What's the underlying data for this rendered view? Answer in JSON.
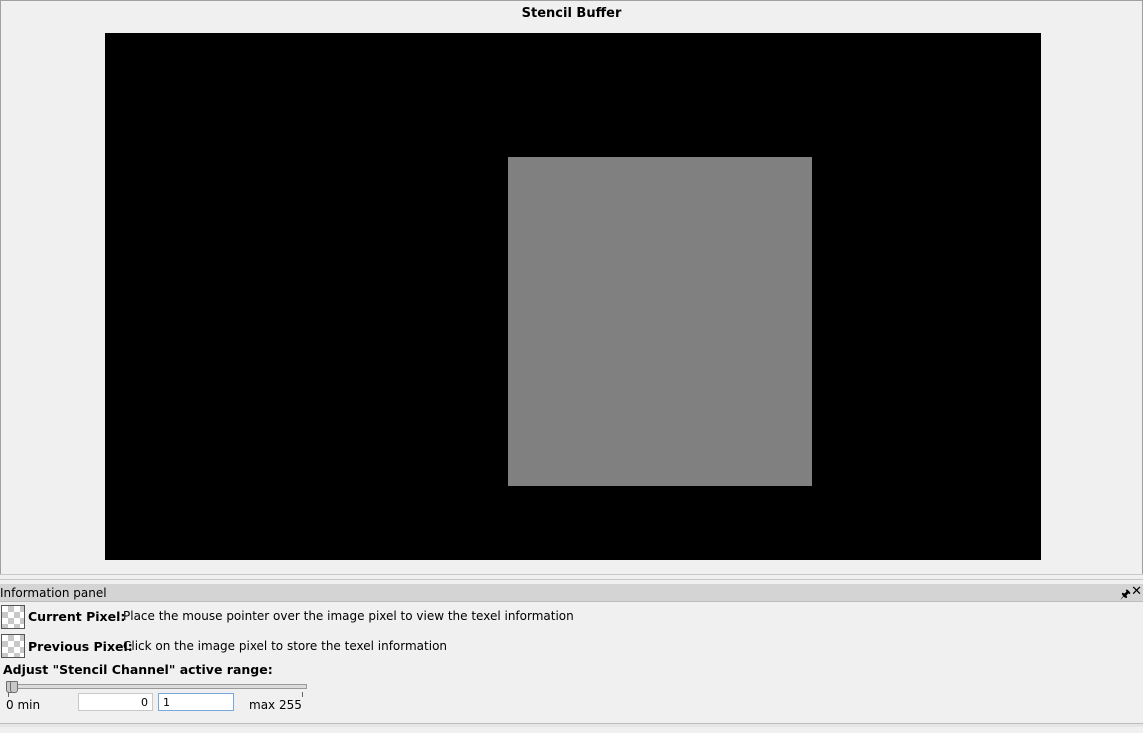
{
  "viewer": {
    "title": "Stencil Buffer"
  },
  "panel": {
    "title": "Information panel",
    "pin_icon": "pin-icon",
    "close_icon": "close-icon",
    "current_pixel": {
      "label": "Current Pixel:",
      "text": "Place the mouse pointer over the image pixel to view the texel information"
    },
    "previous_pixel": {
      "label": "Previous Pixel:",
      "text": "Click on the image pixel to store the texel information"
    },
    "range": {
      "label": "Adjust \"Stencil Channel\" active range:",
      "min_label": "0 min",
      "max_label": "max 255",
      "min_value": "0",
      "max_value": "1",
      "range_min": 0,
      "range_max": 255
    }
  },
  "colors": {
    "canvas_background": "#000000",
    "stencil_region": "#808080"
  }
}
